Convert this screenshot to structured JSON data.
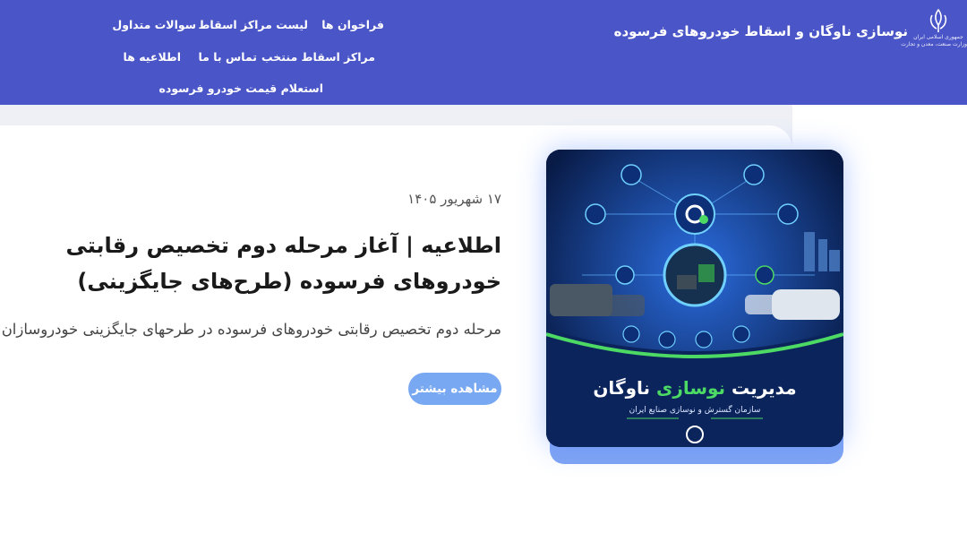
{
  "header": {
    "site_title": "نوسازی ناوگان و اسقاط خودروهای فرسوده",
    "emblem_text": "جمهوری اسلامی ایران",
    "emblem_ministry": "وزارت صنعت، معدن و تجارت",
    "nav": {
      "calls": "فراخوان ها",
      "scrap_centers": "لیست مراکز اسقاط",
      "faq": "سوالات متداول",
      "selected_centers": "مراکز اسقاط منتخب",
      "contact": "تماس با ما",
      "announcements": "اطلاعیه ها",
      "price_inquiry": "استعلام قیمت خودرو فرسوده"
    }
  },
  "article": {
    "date": "۱۷ شهریور ۱۴۰۵",
    "headline": "اطلاعیه | آغاز مرحله دوم تخصیص رقابتی خودروهای فرسوده (طرح‌های جایگزینی)",
    "summary": "مرحله دوم تخصیص رقابتی خودروهای فرسوده در طرحهای جایگزینی خودروسازان",
    "more_label": "مشاهده بیشتر"
  },
  "poster": {
    "title_prefix": "مدیریت",
    "title_highlight": "نوسازی",
    "title_suffix": "ناوگان",
    "subtitle": "سازمان گسترش و نوسازی صنایع ایران",
    "accent_color": "#4cd964",
    "bg_color": "#0a1d4a"
  },
  "colors": {
    "header_bg": "#4a55c8",
    "button_bg": "#78a8f2"
  }
}
